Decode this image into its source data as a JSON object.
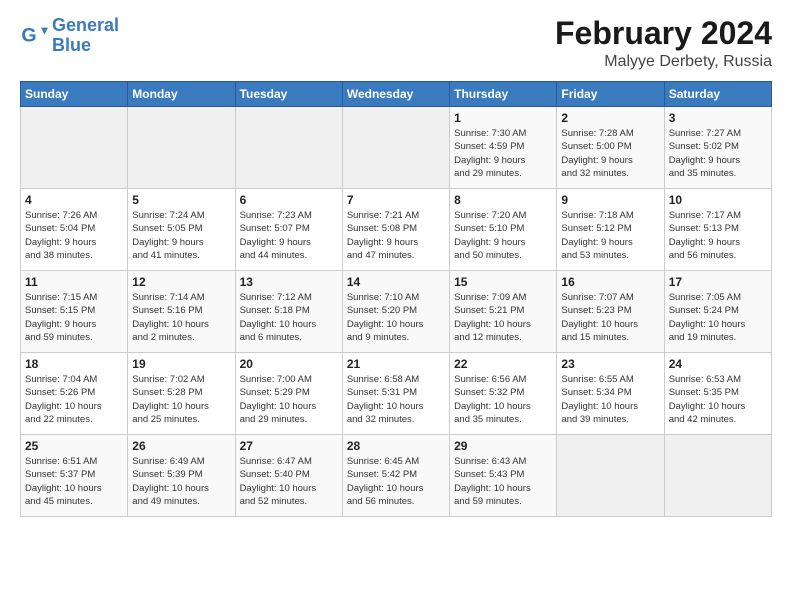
{
  "logo": {
    "text_general": "General",
    "text_blue": "Blue"
  },
  "header": {
    "month": "February 2024",
    "location": "Malyye Derbety, Russia"
  },
  "days_of_week": [
    "Sunday",
    "Monday",
    "Tuesday",
    "Wednesday",
    "Thursday",
    "Friday",
    "Saturday"
  ],
  "weeks": [
    [
      {
        "day": "",
        "info": ""
      },
      {
        "day": "",
        "info": ""
      },
      {
        "day": "",
        "info": ""
      },
      {
        "day": "",
        "info": ""
      },
      {
        "day": "1",
        "info": "Sunrise: 7:30 AM\nSunset: 4:59 PM\nDaylight: 9 hours\nand 29 minutes."
      },
      {
        "day": "2",
        "info": "Sunrise: 7:28 AM\nSunset: 5:00 PM\nDaylight: 9 hours\nand 32 minutes."
      },
      {
        "day": "3",
        "info": "Sunrise: 7:27 AM\nSunset: 5:02 PM\nDaylight: 9 hours\nand 35 minutes."
      }
    ],
    [
      {
        "day": "4",
        "info": "Sunrise: 7:26 AM\nSunset: 5:04 PM\nDaylight: 9 hours\nand 38 minutes."
      },
      {
        "day": "5",
        "info": "Sunrise: 7:24 AM\nSunset: 5:05 PM\nDaylight: 9 hours\nand 41 minutes."
      },
      {
        "day": "6",
        "info": "Sunrise: 7:23 AM\nSunset: 5:07 PM\nDaylight: 9 hours\nand 44 minutes."
      },
      {
        "day": "7",
        "info": "Sunrise: 7:21 AM\nSunset: 5:08 PM\nDaylight: 9 hours\nand 47 minutes."
      },
      {
        "day": "8",
        "info": "Sunrise: 7:20 AM\nSunset: 5:10 PM\nDaylight: 9 hours\nand 50 minutes."
      },
      {
        "day": "9",
        "info": "Sunrise: 7:18 AM\nSunset: 5:12 PM\nDaylight: 9 hours\nand 53 minutes."
      },
      {
        "day": "10",
        "info": "Sunrise: 7:17 AM\nSunset: 5:13 PM\nDaylight: 9 hours\nand 56 minutes."
      }
    ],
    [
      {
        "day": "11",
        "info": "Sunrise: 7:15 AM\nSunset: 5:15 PM\nDaylight: 9 hours\nand 59 minutes."
      },
      {
        "day": "12",
        "info": "Sunrise: 7:14 AM\nSunset: 5:16 PM\nDaylight: 10 hours\nand 2 minutes."
      },
      {
        "day": "13",
        "info": "Sunrise: 7:12 AM\nSunset: 5:18 PM\nDaylight: 10 hours\nand 6 minutes."
      },
      {
        "day": "14",
        "info": "Sunrise: 7:10 AM\nSunset: 5:20 PM\nDaylight: 10 hours\nand 9 minutes."
      },
      {
        "day": "15",
        "info": "Sunrise: 7:09 AM\nSunset: 5:21 PM\nDaylight: 10 hours\nand 12 minutes."
      },
      {
        "day": "16",
        "info": "Sunrise: 7:07 AM\nSunset: 5:23 PM\nDaylight: 10 hours\nand 15 minutes."
      },
      {
        "day": "17",
        "info": "Sunrise: 7:05 AM\nSunset: 5:24 PM\nDaylight: 10 hours\nand 19 minutes."
      }
    ],
    [
      {
        "day": "18",
        "info": "Sunrise: 7:04 AM\nSunset: 5:26 PM\nDaylight: 10 hours\nand 22 minutes."
      },
      {
        "day": "19",
        "info": "Sunrise: 7:02 AM\nSunset: 5:28 PM\nDaylight: 10 hours\nand 25 minutes."
      },
      {
        "day": "20",
        "info": "Sunrise: 7:00 AM\nSunset: 5:29 PM\nDaylight: 10 hours\nand 29 minutes."
      },
      {
        "day": "21",
        "info": "Sunrise: 6:58 AM\nSunset: 5:31 PM\nDaylight: 10 hours\nand 32 minutes."
      },
      {
        "day": "22",
        "info": "Sunrise: 6:56 AM\nSunset: 5:32 PM\nDaylight: 10 hours\nand 35 minutes."
      },
      {
        "day": "23",
        "info": "Sunrise: 6:55 AM\nSunset: 5:34 PM\nDaylight: 10 hours\nand 39 minutes."
      },
      {
        "day": "24",
        "info": "Sunrise: 6:53 AM\nSunset: 5:35 PM\nDaylight: 10 hours\nand 42 minutes."
      }
    ],
    [
      {
        "day": "25",
        "info": "Sunrise: 6:51 AM\nSunset: 5:37 PM\nDaylight: 10 hours\nand 45 minutes."
      },
      {
        "day": "26",
        "info": "Sunrise: 6:49 AM\nSunset: 5:39 PM\nDaylight: 10 hours\nand 49 minutes."
      },
      {
        "day": "27",
        "info": "Sunrise: 6:47 AM\nSunset: 5:40 PM\nDaylight: 10 hours\nand 52 minutes."
      },
      {
        "day": "28",
        "info": "Sunrise: 6:45 AM\nSunset: 5:42 PM\nDaylight: 10 hours\nand 56 minutes."
      },
      {
        "day": "29",
        "info": "Sunrise: 6:43 AM\nSunset: 5:43 PM\nDaylight: 10 hours\nand 59 minutes."
      },
      {
        "day": "",
        "info": ""
      },
      {
        "day": "",
        "info": ""
      }
    ]
  ]
}
